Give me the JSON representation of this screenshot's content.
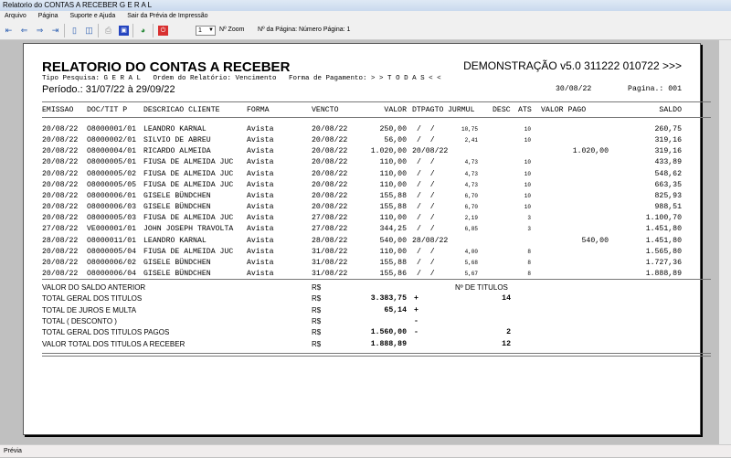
{
  "window": {
    "title": "Relatorio do CONTAS A RECEBER G E R A L"
  },
  "menu": [
    "Arquivo",
    "Página",
    "Suporte e Ajuda",
    "Sair da Prévia de Impressão"
  ],
  "toolbar": {
    "zoom_value": "1",
    "zoom_label": "Nº Zoom",
    "page_label": "Nº da Página: Número Página: 1",
    "icons": [
      "first-page-icon",
      "prev-page-icon",
      "next-page-icon",
      "last-page-icon",
      "single-page-icon",
      "two-pages-icon",
      "print-icon",
      "save-icon",
      "export-icon",
      "close-icon"
    ]
  },
  "report": {
    "title": "RELATORIO DO CONTAS A RECEBER",
    "version": "DEMONSTRAÇÃO v5.0 311222 010722 >>>",
    "subtitle": "Tipo Pesquisa: G E R A L   Ordem do Relatório: Vencimento   Forma de Pagamento: > > T O D A S < <",
    "period": "Período.: 31/07/22 à 29/09/22",
    "date": "30/08/22",
    "page": "Pagina.: 001",
    "columns": {
      "emissao": "EMISSAO",
      "doc": "DOC/TIT P",
      "descr": "DESCRICAO CLIENTE",
      "forma": "FORMA",
      "vencto": "VENCTO",
      "valor": "VALOR",
      "dtpagto": "DTPAGTO",
      "jurmul": "JURMUL",
      "desc": "DESC",
      "ats": "ATS",
      "pago": "VALOR PAGO",
      "saldo": "SALDO"
    },
    "rows": [
      [
        "20/08/22",
        "O8000001/01",
        "LEANDRO KARNAL",
        "Avista",
        "20/08/22",
        "250,00",
        "/  /",
        "10,75",
        "10",
        "",
        "260,75"
      ],
      [
        "20/08/22",
        "O8000002/01",
        "SILVIO DE ABREU",
        "Avista",
        "20/08/22",
        "56,00",
        "/  /",
        "2,41",
        "10",
        "",
        "319,16"
      ],
      [
        "20/08/22",
        "O8000004/01",
        "RICARDO ALMEIDA",
        "Avista",
        "20/08/22",
        "1.020,00",
        "20/08/22",
        "",
        "",
        "1.020,00",
        "319,16"
      ],
      [
        "20/08/22",
        "O8000005/01",
        "FIUSA DE ALMEIDA JUC",
        "Avista",
        "20/08/22",
        "110,00",
        "/  /",
        "4,73",
        "10",
        "",
        "433,89"
      ],
      [
        "20/08/22",
        "O8000005/02",
        "FIUSA DE ALMEIDA JUC",
        "Avista",
        "20/08/22",
        "110,00",
        "/  /",
        "4,73",
        "10",
        "",
        "548,62"
      ],
      [
        "20/08/22",
        "O8000005/05",
        "FIUSA DE ALMEIDA JUC",
        "Avista",
        "20/08/22",
        "110,00",
        "/  /",
        "4,73",
        "10",
        "",
        "663,35"
      ],
      [
        "20/08/22",
        "O8000006/01",
        "GISELE BÜNDCHEN",
        "Avista",
        "20/08/22",
        "155,88",
        "/  /",
        "6,70",
        "10",
        "",
        "825,93"
      ],
      [
        "20/08/22",
        "O8000006/03",
        "GISELE BÜNDCHEN",
        "Avista",
        "20/08/22",
        "155,88",
        "/  /",
        "6,70",
        "10",
        "",
        "988,51"
      ],
      [
        "20/08/22",
        "O8000005/03",
        "FIUSA DE ALMEIDA JUC",
        "Avista",
        "27/08/22",
        "110,00",
        "/  /",
        "2,19",
        "3",
        "",
        "1.100,70"
      ],
      [
        "27/08/22",
        "VE000001/01",
        "JOHN JOSEPH TRAVOLTA",
        "Avista",
        "27/08/22",
        "344,25",
        "/  /",
        "6,85",
        "3",
        "",
        "1.451,80"
      ],
      [
        "28/08/22",
        "O8000011/01",
        "LEANDRO KARNAL",
        "Avista",
        "28/08/22",
        "540,00",
        "28/08/22",
        "",
        "",
        "540,00",
        "1.451,80"
      ],
      [
        "20/08/22",
        "O8000005/04",
        "FIUSA DE ALMEIDA JUC",
        "Avista",
        "31/08/22",
        "110,00",
        "/  /",
        "4,00",
        "8",
        "",
        "1.565,80"
      ],
      [
        "20/08/22",
        "O8000006/02",
        "GISELE BÜNDCHEN",
        "Avista",
        "31/08/22",
        "155,88",
        "/  /",
        "5,68",
        "8",
        "",
        "1.727,36"
      ],
      [
        "20/08/22",
        "O8000006/04",
        "GISELE BÜNDCHEN",
        "Avista",
        "31/08/22",
        "155,86",
        "/  /",
        "5,67",
        "8",
        "",
        "1.888,89"
      ]
    ],
    "summary_count_header": "Nº DE TITULOS",
    "summary": [
      {
        "label": "VALOR DO SALDO ANTERIOR",
        "cur": "R$",
        "value": "",
        "sign": "",
        "count": ""
      },
      {
        "label": "TOTAL GERAL DOS TITULOS",
        "cur": "R$",
        "value": "3.383,75",
        "sign": "+",
        "count": "14"
      },
      {
        "label": "TOTAL DE JUROS E MULTA",
        "cur": "R$",
        "value": "65,14",
        "sign": "+",
        "count": ""
      },
      {
        "label": "TOTAL ( DESCONTO )",
        "cur": "R$",
        "value": "",
        "sign": "-",
        "count": ""
      },
      {
        "label": "TOTAL GERAL DOS TITULOS PAGOS",
        "cur": "R$",
        "value": "1.560,00",
        "sign": "-",
        "count": "2"
      },
      {
        "label": "VALOR TOTAL DOS TITULOS A RECEBER",
        "cur": "R$",
        "value": "1.888,89",
        "sign": "",
        "count": "12"
      }
    ]
  },
  "status": {
    "text": "Prévia"
  }
}
